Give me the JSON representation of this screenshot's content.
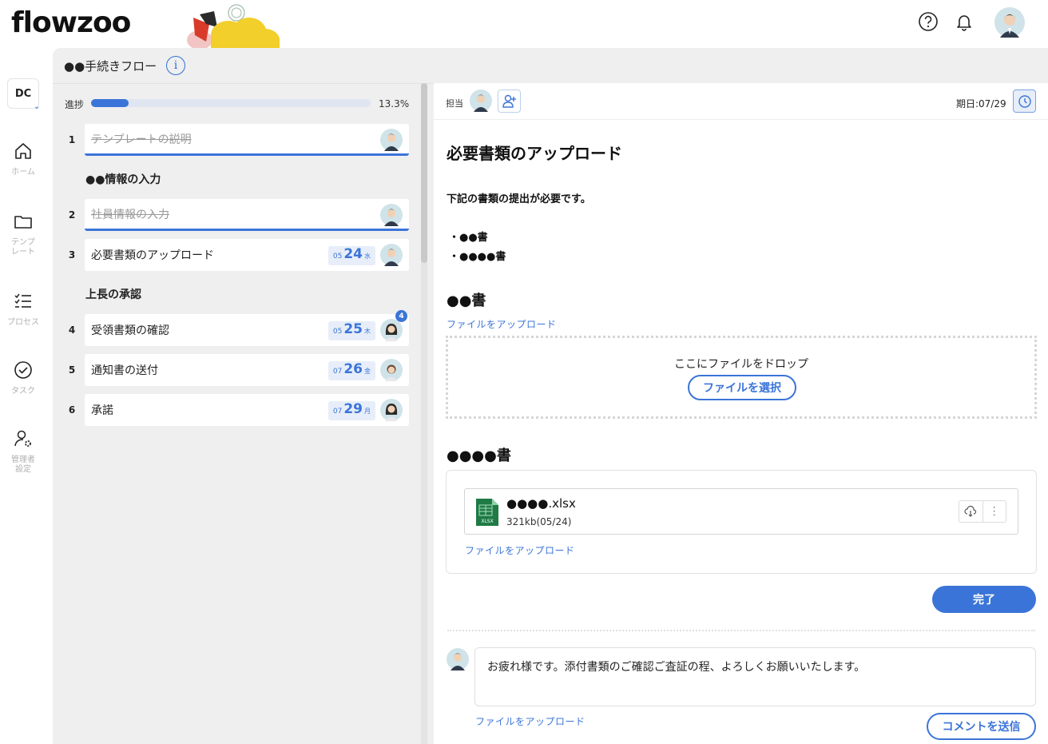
{
  "header": {
    "logo": "flowzoo",
    "help_icon": "help-circle-icon",
    "bell_icon": "bell-icon"
  },
  "nav": {
    "workspace": "DC",
    "items": [
      {
        "label": "ホーム",
        "icon": "home-icon"
      },
      {
        "label": "テンプ\nレート",
        "icon": "folder-icon"
      },
      {
        "label": "プロセス",
        "icon": "list-check-icon"
      },
      {
        "label": "タスク",
        "icon": "check-circle-icon"
      },
      {
        "label": "管理者\n設定",
        "icon": "user-gear-icon"
      }
    ]
  },
  "workflow": {
    "title": "●●手続きフロー",
    "progress_label": "進捗",
    "progress_percent": "13.3%",
    "progress_fraction": 0.133,
    "steps": [
      {
        "num": "1",
        "name": "テンプレートの説明",
        "done": true
      },
      {
        "section": "●●情報の入力"
      },
      {
        "num": "2",
        "name": "社員情報の入力",
        "done": true
      },
      {
        "num": "3",
        "name": "必要書類のアップロード",
        "month": "05",
        "day": "24",
        "weekday": "水"
      },
      {
        "section": "上長の承認"
      },
      {
        "num": "4",
        "name": "受領書類の確認",
        "month": "05",
        "day": "25",
        "weekday": "木",
        "badge": "4"
      },
      {
        "num": "5",
        "name": "通知書の送付",
        "month": "07",
        "day": "26",
        "weekday": "金"
      },
      {
        "num": "6",
        "name": "承諾",
        "month": "07",
        "day": "29",
        "weekday": "月"
      }
    ]
  },
  "detail": {
    "assignee_label": "担当",
    "due_label": "期日:07/29",
    "title": "必要書類のアップロード",
    "description": "下記の書類の提出が必要です。",
    "bullets": [
      "・●●書",
      "・●●●●書"
    ],
    "doc1_heading": "●●書",
    "upload_link": "ファイルをアップロード",
    "drop_text": "ここにファイルをドロップ",
    "select_button": "ファイルを選択",
    "doc2_heading": "●●●●書",
    "file": {
      "name": "●●●●.xlsx",
      "meta": "321kb(05/24)",
      "type_label": "XLSX"
    },
    "complete_button": "完了",
    "comment_text": "お疲れ様です。添付書類のご確認ご査証の程、よろしくお願いいたします。",
    "send_button": "コメントを送信"
  },
  "colors": {
    "accent": "#3b74d8",
    "panel": "#efefef",
    "excel": "#1f7a45"
  }
}
